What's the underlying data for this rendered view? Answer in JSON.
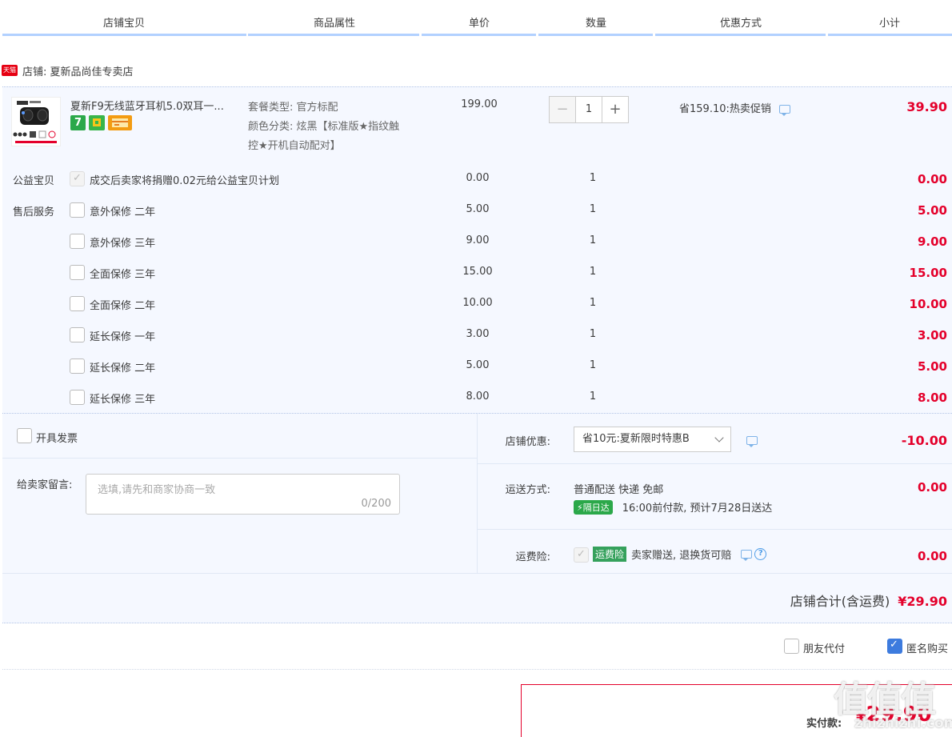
{
  "header": {
    "columns": [
      "店铺宝贝",
      "商品属性",
      "单价",
      "数量",
      "优惠方式",
      "小计"
    ]
  },
  "shop": {
    "badge": "天猫",
    "label": "店铺: 夏新品尚佳专卖店"
  },
  "product": {
    "name": "夏新F9无线蓝牙耳机5.0双耳一...",
    "attr_line1": "套餐类型: 官方标配",
    "attr_line2": "颜色分类: 炫黑【标准版★指纹触",
    "attr_line3": "控★开机自动配对】",
    "badge_number": "7",
    "price": "199.00",
    "qty_minus": "−",
    "qty": "1",
    "qty_plus": "+",
    "promo": "省159.10:热卖促销",
    "subtotal": "39.90"
  },
  "charity": {
    "label": "公益宝贝",
    "text": "成交后卖家将捐赠0.02元给公益宝贝计划",
    "price": "0.00",
    "qty": "1",
    "subtotal": "0.00"
  },
  "after_sales_label": "售后服务",
  "services": [
    {
      "name": "意外保修 二年",
      "price": "5.00",
      "qty": "1",
      "subtotal": "5.00"
    },
    {
      "name": "意外保修 三年",
      "price": "9.00",
      "qty": "1",
      "subtotal": "9.00"
    },
    {
      "name": "全面保修 三年",
      "price": "15.00",
      "qty": "1",
      "subtotal": "15.00"
    },
    {
      "name": "全面保修 二年",
      "price": "10.00",
      "qty": "1",
      "subtotal": "10.00"
    },
    {
      "name": "延长保修 一年",
      "price": "3.00",
      "qty": "1",
      "subtotal": "3.00"
    },
    {
      "name": "延长保修 二年",
      "price": "5.00",
      "qty": "1",
      "subtotal": "5.00"
    },
    {
      "name": "延长保修 三年",
      "price": "8.00",
      "qty": "1",
      "subtotal": "8.00"
    }
  ],
  "invoice": {
    "label": "开具发票"
  },
  "message": {
    "label": "给卖家留言:",
    "placeholder": "选填,请先和商家协商一致",
    "count": "0/200"
  },
  "shop_discount": {
    "label": "店铺优惠:",
    "selected": "省10元:夏新限时特惠B",
    "amount": "-10.00"
  },
  "shipping": {
    "label": "运送方式:",
    "method": "普通配送 快递 免邮",
    "tag": "隔日达",
    "eta": "16:00前付款, 预计7月28日送达",
    "amount": "0.00"
  },
  "insurance": {
    "label": "运费险:",
    "tag": "运费险",
    "text": "卖家赠送, 退换货可赔",
    "help": "?",
    "amount": "0.00"
  },
  "shop_total": {
    "label": "店铺合计(含运费)",
    "amount": "¥29.90"
  },
  "options": {
    "friend_pay": "朋友代付",
    "anonymous": "匿名购买"
  },
  "pay": {
    "label": "实付款:",
    "currency": "¥",
    "amount": "29.90"
  },
  "watermark": {
    "text": "值值值",
    "url": "zhizhizhi.com"
  },
  "colors": {
    "accent_red": "#e4002b",
    "header_bar": "#b2d1ff",
    "panel_bg": "#f5f8ff",
    "check_blue": "#3d7bde",
    "green_tag": "#2ba84a"
  }
}
